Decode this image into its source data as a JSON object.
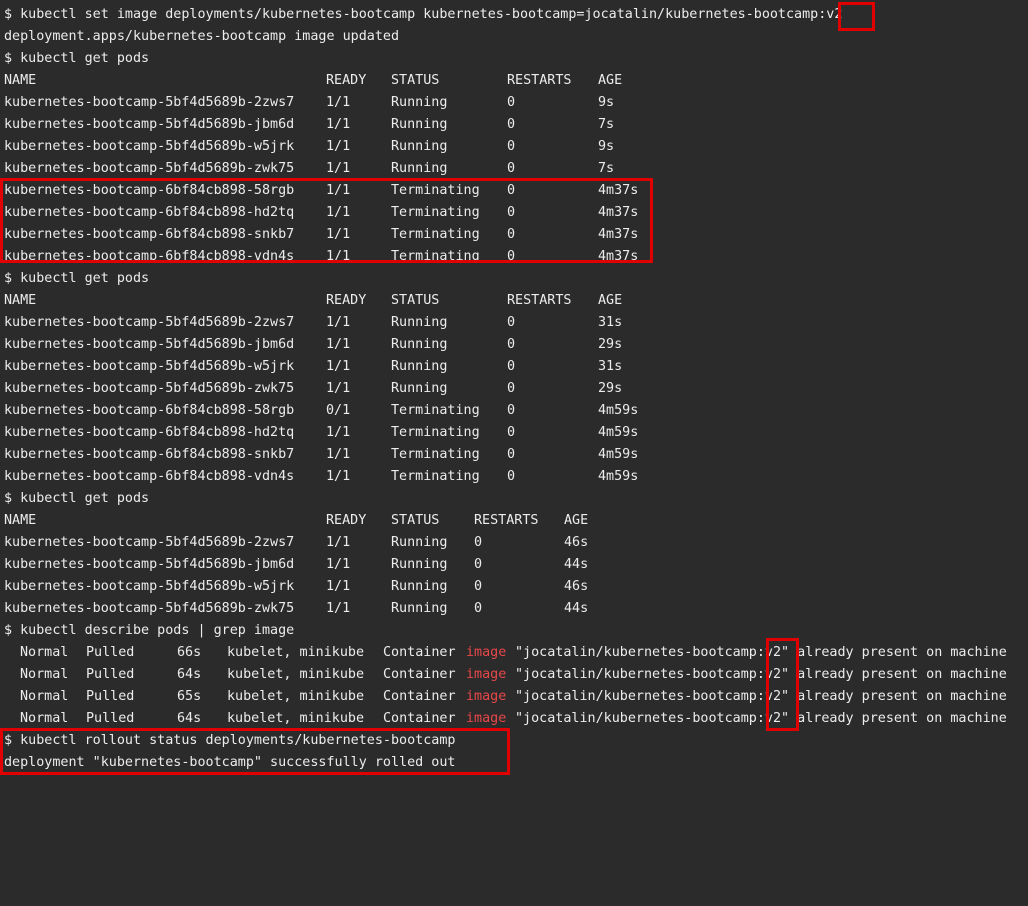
{
  "terminal": {
    "cmd_set_image": "$ kubectl set image deployments/kubernetes-bootcamp kubernetes-bootcamp=jocatalin/kubernetes-bootcamp:v2",
    "out_image_updated": "deployment.apps/kubernetes-bootcamp image updated",
    "cmd_get_pods_1": "$ kubectl get pods",
    "table1": {
      "headers": [
        "NAME",
        "READY",
        "STATUS",
        "RESTARTS",
        "AGE"
      ],
      "rows": [
        [
          "kubernetes-bootcamp-5bf4d5689b-2zws7",
          "1/1",
          "Running",
          "0",
          "9s"
        ],
        [
          "kubernetes-bootcamp-5bf4d5689b-jbm6d",
          "1/1",
          "Running",
          "0",
          "7s"
        ],
        [
          "kubernetes-bootcamp-5bf4d5689b-w5jrk",
          "1/1",
          "Running",
          "0",
          "9s"
        ],
        [
          "kubernetes-bootcamp-5bf4d5689b-zwk75",
          "1/1",
          "Running",
          "0",
          "7s"
        ],
        [
          "kubernetes-bootcamp-6bf84cb898-58rgb",
          "1/1",
          "Terminating",
          "0",
          "4m37s"
        ],
        [
          "kubernetes-bootcamp-6bf84cb898-hd2tq",
          "1/1",
          "Terminating",
          "0",
          "4m37s"
        ],
        [
          "kubernetes-bootcamp-6bf84cb898-snkb7",
          "1/1",
          "Terminating",
          "0",
          "4m37s"
        ],
        [
          "kubernetes-bootcamp-6bf84cb898-vdn4s",
          "1/1",
          "Terminating",
          "0",
          "4m37s"
        ]
      ]
    },
    "cmd_get_pods_2": "$ kubectl get pods",
    "table2": {
      "headers": [
        "NAME",
        "READY",
        "STATUS",
        "RESTARTS",
        "AGE"
      ],
      "rows": [
        [
          "kubernetes-bootcamp-5bf4d5689b-2zws7",
          "1/1",
          "Running",
          "0",
          "31s"
        ],
        [
          "kubernetes-bootcamp-5bf4d5689b-jbm6d",
          "1/1",
          "Running",
          "0",
          "29s"
        ],
        [
          "kubernetes-bootcamp-5bf4d5689b-w5jrk",
          "1/1",
          "Running",
          "0",
          "31s"
        ],
        [
          "kubernetes-bootcamp-5bf4d5689b-zwk75",
          "1/1",
          "Running",
          "0",
          "29s"
        ],
        [
          "kubernetes-bootcamp-6bf84cb898-58rgb",
          "0/1",
          "Terminating",
          "0",
          "4m59s"
        ],
        [
          "kubernetes-bootcamp-6bf84cb898-hd2tq",
          "1/1",
          "Terminating",
          "0",
          "4m59s"
        ],
        [
          "kubernetes-bootcamp-6bf84cb898-snkb7",
          "1/1",
          "Terminating",
          "0",
          "4m59s"
        ],
        [
          "kubernetes-bootcamp-6bf84cb898-vdn4s",
          "1/1",
          "Terminating",
          "0",
          "4m59s"
        ]
      ]
    },
    "cmd_get_pods_3": "$ kubectl get pods",
    "table3": {
      "headers": [
        "NAME",
        "READY",
        "STATUS",
        "RESTARTS",
        "AGE"
      ],
      "rows": [
        [
          "kubernetes-bootcamp-5bf4d5689b-2zws7",
          "1/1",
          "Running",
          "0",
          "46s"
        ],
        [
          "kubernetes-bootcamp-5bf4d5689b-jbm6d",
          "1/1",
          "Running",
          "0",
          "44s"
        ],
        [
          "kubernetes-bootcamp-5bf4d5689b-w5jrk",
          "1/1",
          "Running",
          "0",
          "46s"
        ],
        [
          "kubernetes-bootcamp-5bf4d5689b-zwk75",
          "1/1",
          "Running",
          "0",
          "44s"
        ]
      ]
    },
    "cmd_describe": "$ kubectl describe pods | grep image",
    "describe_lines": [
      {
        "type": "Normal",
        "reason": "Pulled",
        "age": "66s",
        "from": "kubelet, minikube",
        "pre": "Container",
        "match": "image",
        "post": "\"jocatalin/kubernetes-bootcamp:v2\" already present on machine"
      },
      {
        "type": "Normal",
        "reason": "Pulled",
        "age": "64s",
        "from": "kubelet, minikube",
        "pre": "Container",
        "match": "image",
        "post": "\"jocatalin/kubernetes-bootcamp:v2\" already present on machine"
      },
      {
        "type": "Normal",
        "reason": "Pulled",
        "age": "65s",
        "from": "kubelet, minikube",
        "pre": "Container",
        "match": "image",
        "post": "\"jocatalin/kubernetes-bootcamp:v2\" already present on machine"
      },
      {
        "type": "Normal",
        "reason": "Pulled",
        "age": "64s",
        "from": "kubelet, minikube",
        "pre": "Container",
        "match": "image",
        "post": "\"jocatalin/kubernetes-bootcamp:v2\" already present on machine"
      }
    ],
    "cmd_rollout": "$ kubectl rollout status deployments/kubernetes-bootcamp",
    "out_rollout": "deployment \"kubernetes-bootcamp\" successfully rolled out"
  },
  "colors": {
    "background": "#2b2b2b",
    "text": "#ececec",
    "grep_match": "#e8474a",
    "highlight_box": "#e00000"
  }
}
